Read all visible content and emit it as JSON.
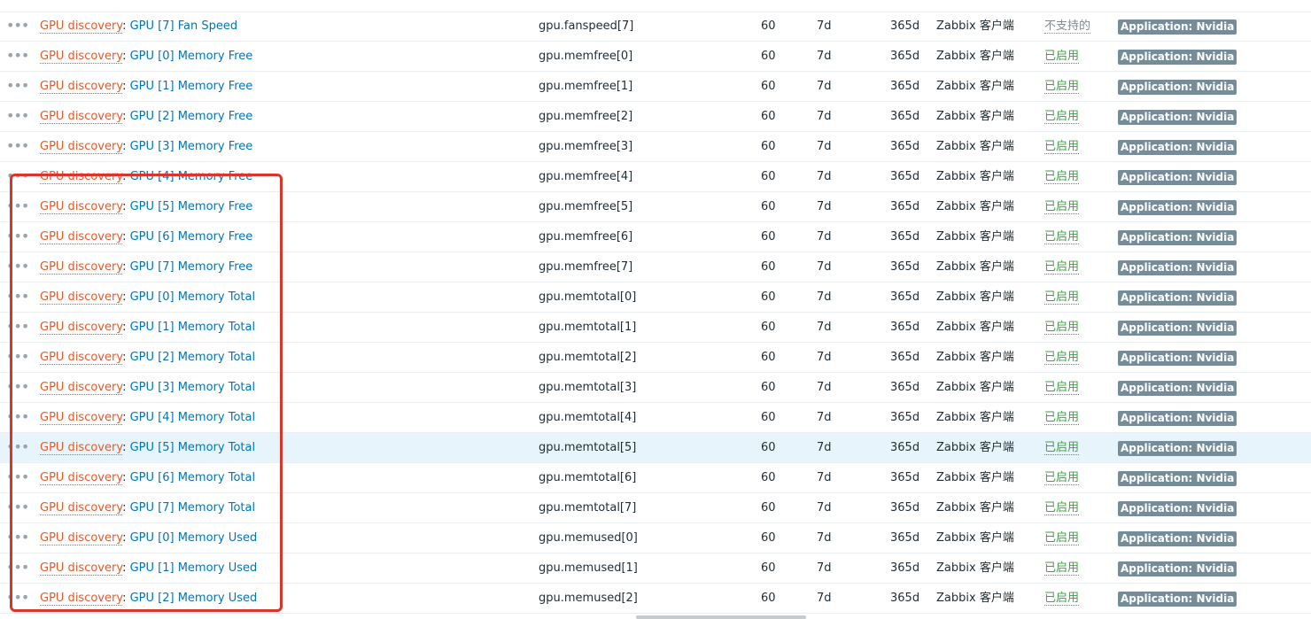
{
  "colors": {
    "prefix": "#e45a2b",
    "item_name": "#0275b8",
    "status_enabled": "#429e47",
    "status_unsupported": "#7f8b93",
    "app_tag_bg": "#768d99",
    "highlight_box": "#d9362a",
    "row_highlight": "#e8f4fc"
  },
  "more_icon": "ellipsis-icon",
  "rows": [
    {
      "prefix": "GPU discovery",
      "name": "GPU [7] Fan Speed",
      "key": "gpu.fanspeed[7]",
      "interval": "60",
      "history": "7d",
      "trends": "365d",
      "type": "Zabbix 客户端",
      "status": "不支持的",
      "app": "Application: Nvidia"
    },
    {
      "prefix": "GPU discovery",
      "name": "GPU [0] Memory Free",
      "key": "gpu.memfree[0]",
      "interval": "60",
      "history": "7d",
      "trends": "365d",
      "type": "Zabbix 客户端",
      "status": "已启用",
      "app": "Application: Nvidia"
    },
    {
      "prefix": "GPU discovery",
      "name": "GPU [1] Memory Free",
      "key": "gpu.memfree[1]",
      "interval": "60",
      "history": "7d",
      "trends": "365d",
      "type": "Zabbix 客户端",
      "status": "已启用",
      "app": "Application: Nvidia"
    },
    {
      "prefix": "GPU discovery",
      "name": "GPU [2] Memory Free",
      "key": "gpu.memfree[2]",
      "interval": "60",
      "history": "7d",
      "trends": "365d",
      "type": "Zabbix 客户端",
      "status": "已启用",
      "app": "Application: Nvidia"
    },
    {
      "prefix": "GPU discovery",
      "name": "GPU [3] Memory Free",
      "key": "gpu.memfree[3]",
      "interval": "60",
      "history": "7d",
      "trends": "365d",
      "type": "Zabbix 客户端",
      "status": "已启用",
      "app": "Application: Nvidia"
    },
    {
      "prefix": "GPU discovery",
      "name": "GPU [4] Memory Free",
      "key": "gpu.memfree[4]",
      "interval": "60",
      "history": "7d",
      "trends": "365d",
      "type": "Zabbix 客户端",
      "status": "已启用",
      "app": "Application: Nvidia"
    },
    {
      "prefix": "GPU discovery",
      "name": "GPU [5] Memory Free",
      "key": "gpu.memfree[5]",
      "interval": "60",
      "history": "7d",
      "trends": "365d",
      "type": "Zabbix 客户端",
      "status": "已启用",
      "app": "Application: Nvidia"
    },
    {
      "prefix": "GPU discovery",
      "name": "GPU [6] Memory Free",
      "key": "gpu.memfree[6]",
      "interval": "60",
      "history": "7d",
      "trends": "365d",
      "type": "Zabbix 客户端",
      "status": "已启用",
      "app": "Application: Nvidia"
    },
    {
      "prefix": "GPU discovery",
      "name": "GPU [7] Memory Free",
      "key": "gpu.memfree[7]",
      "interval": "60",
      "history": "7d",
      "trends": "365d",
      "type": "Zabbix 客户端",
      "status": "已启用",
      "app": "Application: Nvidia"
    },
    {
      "prefix": "GPU discovery",
      "name": "GPU [0] Memory Total",
      "key": "gpu.memtotal[0]",
      "interval": "60",
      "history": "7d",
      "trends": "365d",
      "type": "Zabbix 客户端",
      "status": "已启用",
      "app": "Application: Nvidia"
    },
    {
      "prefix": "GPU discovery",
      "name": "GPU [1] Memory Total",
      "key": "gpu.memtotal[1]",
      "interval": "60",
      "history": "7d",
      "trends": "365d",
      "type": "Zabbix 客户端",
      "status": "已启用",
      "app": "Application: Nvidia"
    },
    {
      "prefix": "GPU discovery",
      "name": "GPU [2] Memory Total",
      "key": "gpu.memtotal[2]",
      "interval": "60",
      "history": "7d",
      "trends": "365d",
      "type": "Zabbix 客户端",
      "status": "已启用",
      "app": "Application: Nvidia"
    },
    {
      "prefix": "GPU discovery",
      "name": "GPU [3] Memory Total",
      "key": "gpu.memtotal[3]",
      "interval": "60",
      "history": "7d",
      "trends": "365d",
      "type": "Zabbix 客户端",
      "status": "已启用",
      "app": "Application: Nvidia"
    },
    {
      "prefix": "GPU discovery",
      "name": "GPU [4] Memory Total",
      "key": "gpu.memtotal[4]",
      "interval": "60",
      "history": "7d",
      "trends": "365d",
      "type": "Zabbix 客户端",
      "status": "已启用",
      "app": "Application: Nvidia"
    },
    {
      "prefix": "GPU discovery",
      "name": "GPU [5] Memory Total",
      "key": "gpu.memtotal[5]",
      "interval": "60",
      "history": "7d",
      "trends": "365d",
      "type": "Zabbix 客户端",
      "status": "已启用",
      "app": "Application: Nvidia"
    },
    {
      "prefix": "GPU discovery",
      "name": "GPU [6] Memory Total",
      "key": "gpu.memtotal[6]",
      "interval": "60",
      "history": "7d",
      "trends": "365d",
      "type": "Zabbix 客户端",
      "status": "已启用",
      "app": "Application: Nvidia"
    },
    {
      "prefix": "GPU discovery",
      "name": "GPU [7] Memory Total",
      "key": "gpu.memtotal[7]",
      "interval": "60",
      "history": "7d",
      "trends": "365d",
      "type": "Zabbix 客户端",
      "status": "已启用",
      "app": "Application: Nvidia"
    },
    {
      "prefix": "GPU discovery",
      "name": "GPU [0] Memory Used",
      "key": "gpu.memused[0]",
      "interval": "60",
      "history": "7d",
      "trends": "365d",
      "type": "Zabbix 客户端",
      "status": "已启用",
      "app": "Application: Nvidia"
    },
    {
      "prefix": "GPU discovery",
      "name": "GPU [1] Memory Used",
      "key": "gpu.memused[1]",
      "interval": "60",
      "history": "7d",
      "trends": "365d",
      "type": "Zabbix 客户端",
      "status": "已启用",
      "app": "Application: Nvidia"
    },
    {
      "prefix": "GPU discovery",
      "name": "GPU [2] Memory Used",
      "key": "gpu.memused[2]",
      "interval": "60",
      "history": "7d",
      "trends": "365d",
      "type": "Zabbix 客户端",
      "status": "已启用",
      "app": "Application: Nvidia"
    }
  ]
}
